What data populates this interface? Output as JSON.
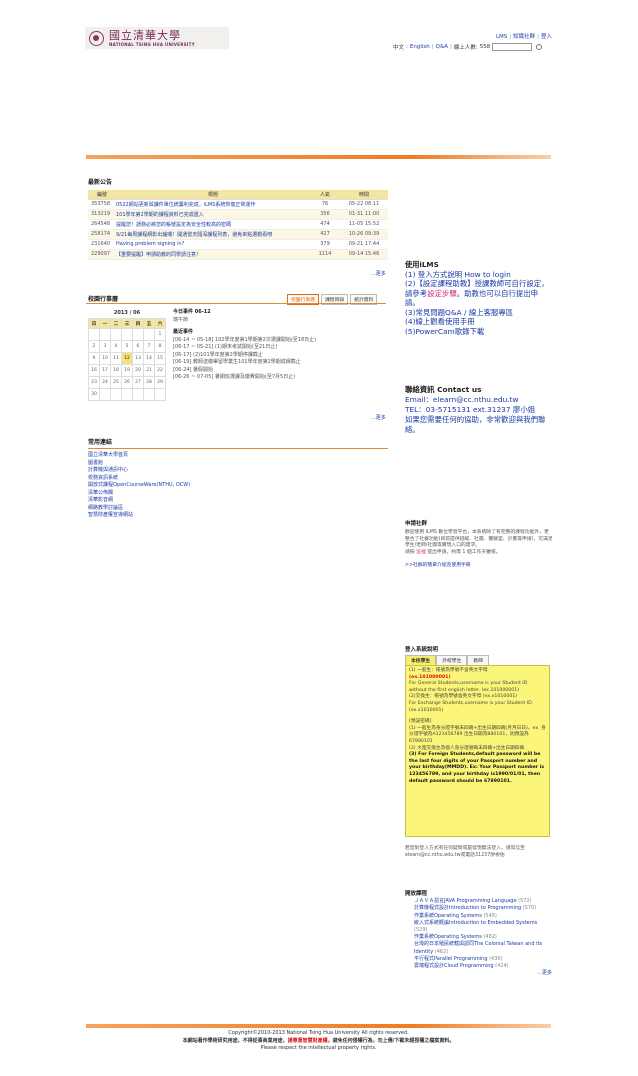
{
  "header": {
    "logo_cn": "國立清華大學",
    "logo_en": "NATIONAL TSING HUA UNIVERSITY",
    "top_links": [
      "LMS",
      "知識社群",
      "登入"
    ],
    "lang_label": "中文",
    "lang_en": "English",
    "qa": "Q&A",
    "online_label": "線上人數:",
    "online_count": "558"
  },
  "news": {
    "title": "最新公告",
    "columns": [
      "編號",
      "標題",
      "人氣",
      "時間"
    ],
    "rows": [
      {
        "id": "353758",
        "title": "0522網站更新與課件單位統籌利完成，iLMS系統恢復正常運作",
        "views": "76",
        "time": "05-22 08:11"
      },
      {
        "id": "313219",
        "title": "101學年第2學期的課程資料已完成匯入",
        "views": "356",
        "time": "01-31 11:00"
      },
      {
        "id": "264548",
        "title": "提醒您！請務必將您的帳號設定為安全性較高的密碼",
        "views": "474",
        "time": "11-05 15:52"
      },
      {
        "id": "258174",
        "title": "9/21每周課程網影出爐囉！開通當天隨深課程列表，避免來點選觀看唷",
        "views": "427",
        "time": "10-26 09:39"
      },
      {
        "id": "231640",
        "title": "Having problem signing in?",
        "views": "379",
        "time": "09-21 17:44"
      },
      {
        "id": "229097",
        "title": "【重要提醒】申請助教的同學請注意！",
        "views": "1114",
        "time": "09-14 15:46"
      }
    ],
    "more": "...更多"
  },
  "calendar": {
    "title": "校園行事曆",
    "tabs": [
      "校園行事曆",
      "課程目錄",
      "統計資料"
    ],
    "month": "2013 / 06",
    "weekdays": [
      "日",
      "一",
      "二",
      "三",
      "四",
      "五",
      "六"
    ],
    "weeks": [
      [
        "",
        "",
        "",
        "",
        "",
        "",
        "1"
      ],
      [
        "2",
        "3",
        "4",
        "5",
        "6",
        "7",
        "8"
      ],
      [
        "9",
        "10",
        "11",
        "12",
        "13",
        "14",
        "15"
      ],
      [
        "16",
        "17",
        "18",
        "19",
        "20",
        "21",
        "22"
      ],
      [
        "23",
        "24",
        "25",
        "26",
        "27",
        "28",
        "29"
      ],
      [
        "30",
        "",
        "",
        "",
        "",
        "",
        ""
      ]
    ],
    "today_day": "12",
    "today_title": "今日事件 06-12",
    "today_event": "端午節",
    "recent_title": "最近事件",
    "recent_events": [
      "[06-14 ~ 05-18] 102學年度第1學期第2次選課開始(至18日止)",
      "[06-17 ~ 05-21] (1)期末考試開始(至21日止)",
      "[06-17] (2)101學年度第2學期停課截止",
      "[06-19] 教師送繳畢留學業生101學年度第2學期成績截止",
      "[06-24] 暑假開始",
      "[06-26 ~ 07-05] 暑期班選課及繳費開始(至7月5日止)"
    ],
    "more": "...更多"
  },
  "links": {
    "title": "常用連結",
    "items": [
      "國立清華大學首頁",
      "圖書館",
      "計算機與通訊中心",
      "校務資訊系統",
      "開放式課程OpenCourseWare(NTHU, OCW)",
      "清華公佈欄",
      "清華影音網",
      "網路教學討論區",
      "智慧財產權宣導網站"
    ]
  },
  "ilms_help": {
    "title": "使用iLMS",
    "items": [
      "(1) 登入方式說明 How to login",
      "(2)【設定課程助教】授課教師可自行設定，請參考",
      "設定步驟",
      "。助教也可以自行提出申請。",
      "(3)常見問題Q&A / 線上客服專區",
      "(4)線上觀看使用手冊",
      "(5)PowerCam歌錄下載"
    ]
  },
  "contact": {
    "title": "聯絡資訊 Contact us",
    "email": "Email：elearn@cc.nthu.edu.tw",
    "tel": "TEL：03-5715131 ext.31237 廖小姐",
    "note": "如果您需要任何的協助，非常歡迎與我們聯絡。"
  },
  "community": {
    "title": "申請社群",
    "body": "歡迎使用 iLMS 數位學習平台，本系統除了有完整的課程功能外，更整合了社群功能(目前提供班級、社團、實驗室、計畫等申請)，可滿足學生/老師/社團等實現入口的需求。",
    "apply_pre": "請按",
    "apply_link": "這裡",
    "apply_post": "提出申請，約需 1 個工作天審核。",
    "intro_link": ">>社群的簡單介紹及使用手冊"
  },
  "login_help": {
    "title": "登入系統說明",
    "tabs": [
      "本校學生",
      "外校學生",
      "教師"
    ],
    "lines": [
      "(1) 一般生：帳號為學號不含英文字母",
      "(ex.101000001)",
      "For General Students,username is your Student ID without the first english letter. (ex.101000001)",
      "(2)交換生：帳號為學號含英文字母 (ex.x1010001)",
      "For Exchange Students,username is your Student ID. (ex.x1010001)",
      "[預設密碼]",
      "(1) 一般生為身分證字號末四碼+出生日期四碼(月月日日)，ex. 身分證字號為A123456789 出生日期為880101，則預設為67890101",
      "(2) 大陸交換生為個人身分證號碼末四碼+出生日期四碼",
      "(3) For Foreign Students,default password will be the last four digits of your Passport number and your birthday(MMDD). Ex: Your Passport number is 123456789, and your birthday is1990/01/01, then default password should be 67890101."
    ],
    "foot": "若您對登入方式有任何疑問或是發現無法登入，請寫信至elearn@cc.nthu.edu.tw或電話31237廖視佑"
  },
  "courses": {
    "title": "開放課程",
    "items": [
      {
        "name": "ＪＡＶＡ語言JAVA Programming Language",
        "count": "(572)"
      },
      {
        "name": "計算機程式設計Introduction to Programming",
        "count": "(570)"
      },
      {
        "name": "作業系統Operating Systems",
        "count": "(545)"
      },
      {
        "name": "嵌入式系統概論Introduction to Embedded Systems",
        "count": "(529)"
      },
      {
        "name": "作業系統Operating Systems",
        "count": "(482)"
      },
      {
        "name": "台灣的日本殖民統轄與認同The Colonial Taiwan and its Identity",
        "count": "(462)"
      },
      {
        "name": "平行程式Parallel Programming",
        "count": "(436)"
      },
      {
        "name": "雲端程式設計Cloud Programming",
        "count": "(424)"
      }
    ],
    "more": "...更多"
  },
  "footer": {
    "copyright": "Copyright©2010-2013 National Tsing Hua University All rights reserved.",
    "notice_pre": "本網站著作學術研究用途，不得從事商業用途，",
    "notice_red": "請尊重智慧財產權",
    "notice_post": "，避免任何侵權行為，勿上傳/下載未經授權之檔案資料。",
    "respect": "Please respect the intellectual property rights."
  }
}
